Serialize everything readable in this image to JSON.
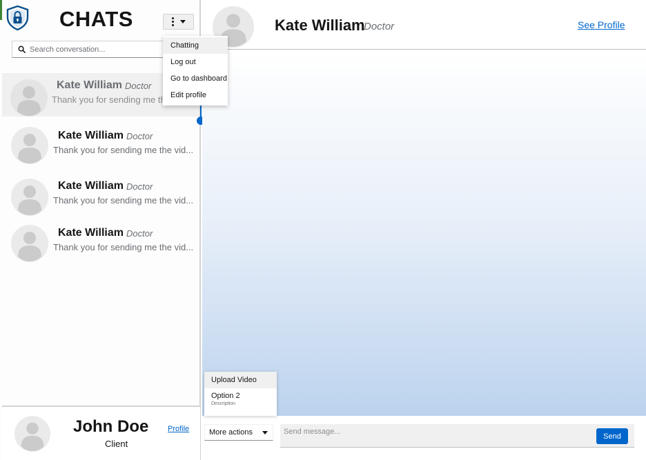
{
  "sidebar": {
    "title": "CHATS",
    "search": {
      "placeholder": "Search conversation...",
      "value": ""
    },
    "conversations": [
      {
        "name": "Kate William",
        "role": "Doctor",
        "preview": "Thank you for sending me the video",
        "active": true
      },
      {
        "name": "Kate William",
        "role": "Doctor",
        "preview": "Thank you for sending me the vid...",
        "active": false
      },
      {
        "name": "Kate William",
        "role": "Doctor",
        "preview": "Thank you for sending me the vid...",
        "active": false
      },
      {
        "name": "Kate William",
        "role": "Doctor",
        "preview": "Thank you for sending me the vid...",
        "active": false
      }
    ],
    "footer": {
      "name": "John Doe",
      "role": "Client",
      "profile_link": "Profile"
    }
  },
  "kebab_menu": {
    "items": [
      {
        "label": "Chatting"
      },
      {
        "label": "Log out"
      },
      {
        "label": "Go to dashboard"
      },
      {
        "label": "Edit profile"
      }
    ]
  },
  "chat": {
    "header": {
      "name": "Kate William",
      "role": "Doctor",
      "see_profile": "See Profile"
    },
    "actions_menu": {
      "upload_label": "Upload Video",
      "option2_label": "Option 2",
      "option2_description": "Description"
    },
    "composer": {
      "more_actions_label": "More actions",
      "placeholder": "Send message...",
      "value": "",
      "send_label": "Send"
    }
  },
  "colors": {
    "accent": "#0066cc",
    "brand_green": "#3e8635",
    "logo_blue": "#0b4f8c",
    "chat_gradient_end": "#bcd3ee"
  },
  "icons": [
    "lock-shield-icon",
    "kebab-icon",
    "caret-down-icon",
    "search-icon",
    "avatar-icon"
  ]
}
